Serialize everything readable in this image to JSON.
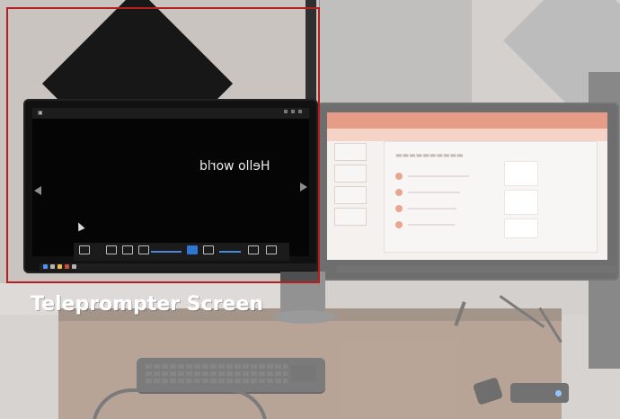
{
  "caption": "Teleprompter Screen",
  "screen_text": "Hello world",
  "colors": {
    "highlight": "#b61f1f",
    "caption": "#ffffff",
    "accent": "#d6613e"
  },
  "icons": [
    "arrow-left-icon",
    "arrow-right-icon",
    "cursor-icon",
    "slider-icon",
    "teleprompter-icon"
  ]
}
